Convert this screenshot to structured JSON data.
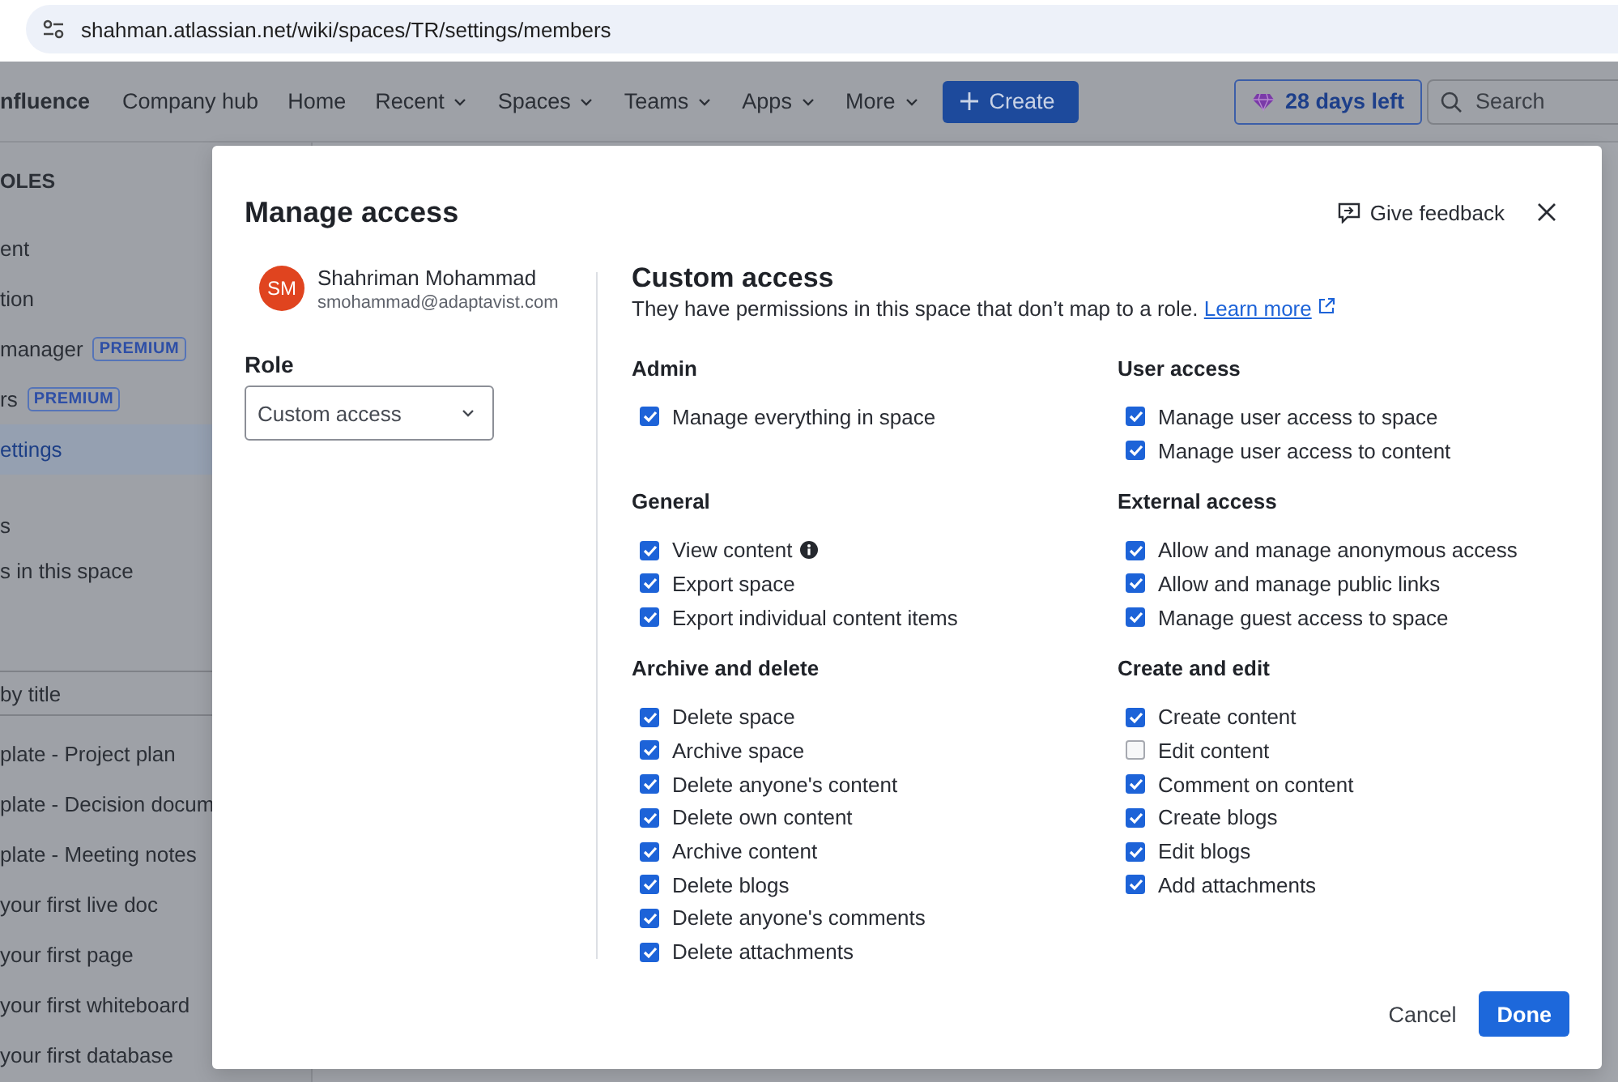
{
  "address_bar": {
    "url": "shahman.atlassian.net/wiki/spaces/TR/settings/members"
  },
  "top_nav": {
    "product": "nfluence",
    "items": [
      {
        "label": "Company hub",
        "dropdown": false
      },
      {
        "label": "Home",
        "dropdown": false
      },
      {
        "label": "Recent",
        "dropdown": true
      },
      {
        "label": "Spaces",
        "dropdown": true
      },
      {
        "label": "Teams",
        "dropdown": true
      },
      {
        "label": "Apps",
        "dropdown": true
      },
      {
        "label": "More",
        "dropdown": true
      }
    ],
    "create_button": "Create",
    "trial_button": "28 days left",
    "search": {
      "placeholder": "Search"
    }
  },
  "sidebar": {
    "heading": "OLES",
    "items": [
      {
        "label": "ent",
        "selected": false
      },
      {
        "label": "tion",
        "selected": false
      },
      {
        "label": "manager",
        "badge": "PREMIUM",
        "selected": false
      },
      {
        "label": "rs",
        "badge": "PREMIUM",
        "selected": false
      },
      {
        "label": "ettings",
        "selected": true
      }
    ],
    "group_heading": "s",
    "group_items": [
      "s in this space"
    ],
    "filter": {
      "placeholder": "by title"
    },
    "pages": [
      "plate - Project plan",
      "plate - Decision docum",
      "plate - Meeting notes",
      "your first live doc",
      "your first page",
      "your first whiteboard",
      "your first database"
    ]
  },
  "dialog": {
    "title": "Manage access",
    "feedback": "Give feedback",
    "user": {
      "initials": "SM",
      "name": "Shahriman Mohammad",
      "email": "smohammad@adaptavist.com"
    },
    "role_label": "Role",
    "role_select": "Custom access",
    "access_title": "Custom access",
    "access_description": "They have permissions in this space that don’t map to a role.",
    "learn_more": "Learn more",
    "permission_groups": [
      {
        "title": "Admin",
        "items": [
          {
            "label": "Manage everything in space",
            "checked": true
          }
        ]
      },
      {
        "title": "User access",
        "items": [
          {
            "label": "Manage user access to space",
            "checked": true
          },
          {
            "label": "Manage user access to content",
            "checked": true
          }
        ]
      },
      {
        "title": "General",
        "items": [
          {
            "label": "View content",
            "checked": true,
            "info": true
          },
          {
            "label": "Export space",
            "checked": true,
            "info": false
          },
          {
            "label": "Export individual content items",
            "checked": true,
            "info": false
          }
        ]
      },
      {
        "title": "External access",
        "items": [
          {
            "label": "Allow and manage anonymous access",
            "checked": true
          },
          {
            "label": "Allow and manage public links",
            "checked": true
          },
          {
            "label": "Manage guest access to space",
            "checked": true
          }
        ]
      },
      {
        "title": "Archive and delete",
        "items": [
          {
            "label": "Delete space",
            "checked": true
          },
          {
            "label": "Archive space",
            "checked": true
          },
          {
            "label": "Delete anyone's content",
            "checked": true
          },
          {
            "label": "Delete own content",
            "checked": true
          },
          {
            "label": "Archive content",
            "checked": true
          },
          {
            "label": "Delete blogs",
            "checked": true
          },
          {
            "label": "Delete anyone's comments",
            "checked": true
          },
          {
            "label": "Delete attachments",
            "checked": true
          }
        ]
      },
      {
        "title": "Create and edit",
        "items": [
          {
            "label": "Create content",
            "checked": true
          },
          {
            "label": "Edit content",
            "checked": false
          },
          {
            "label": "Comment on content",
            "checked": true
          },
          {
            "label": "Create blogs",
            "checked": true
          },
          {
            "label": "Edit blogs",
            "checked": true
          },
          {
            "label": "Add attachments",
            "checked": true
          }
        ]
      }
    ],
    "cancel_button": "Cancel",
    "done_button": "Done"
  }
}
